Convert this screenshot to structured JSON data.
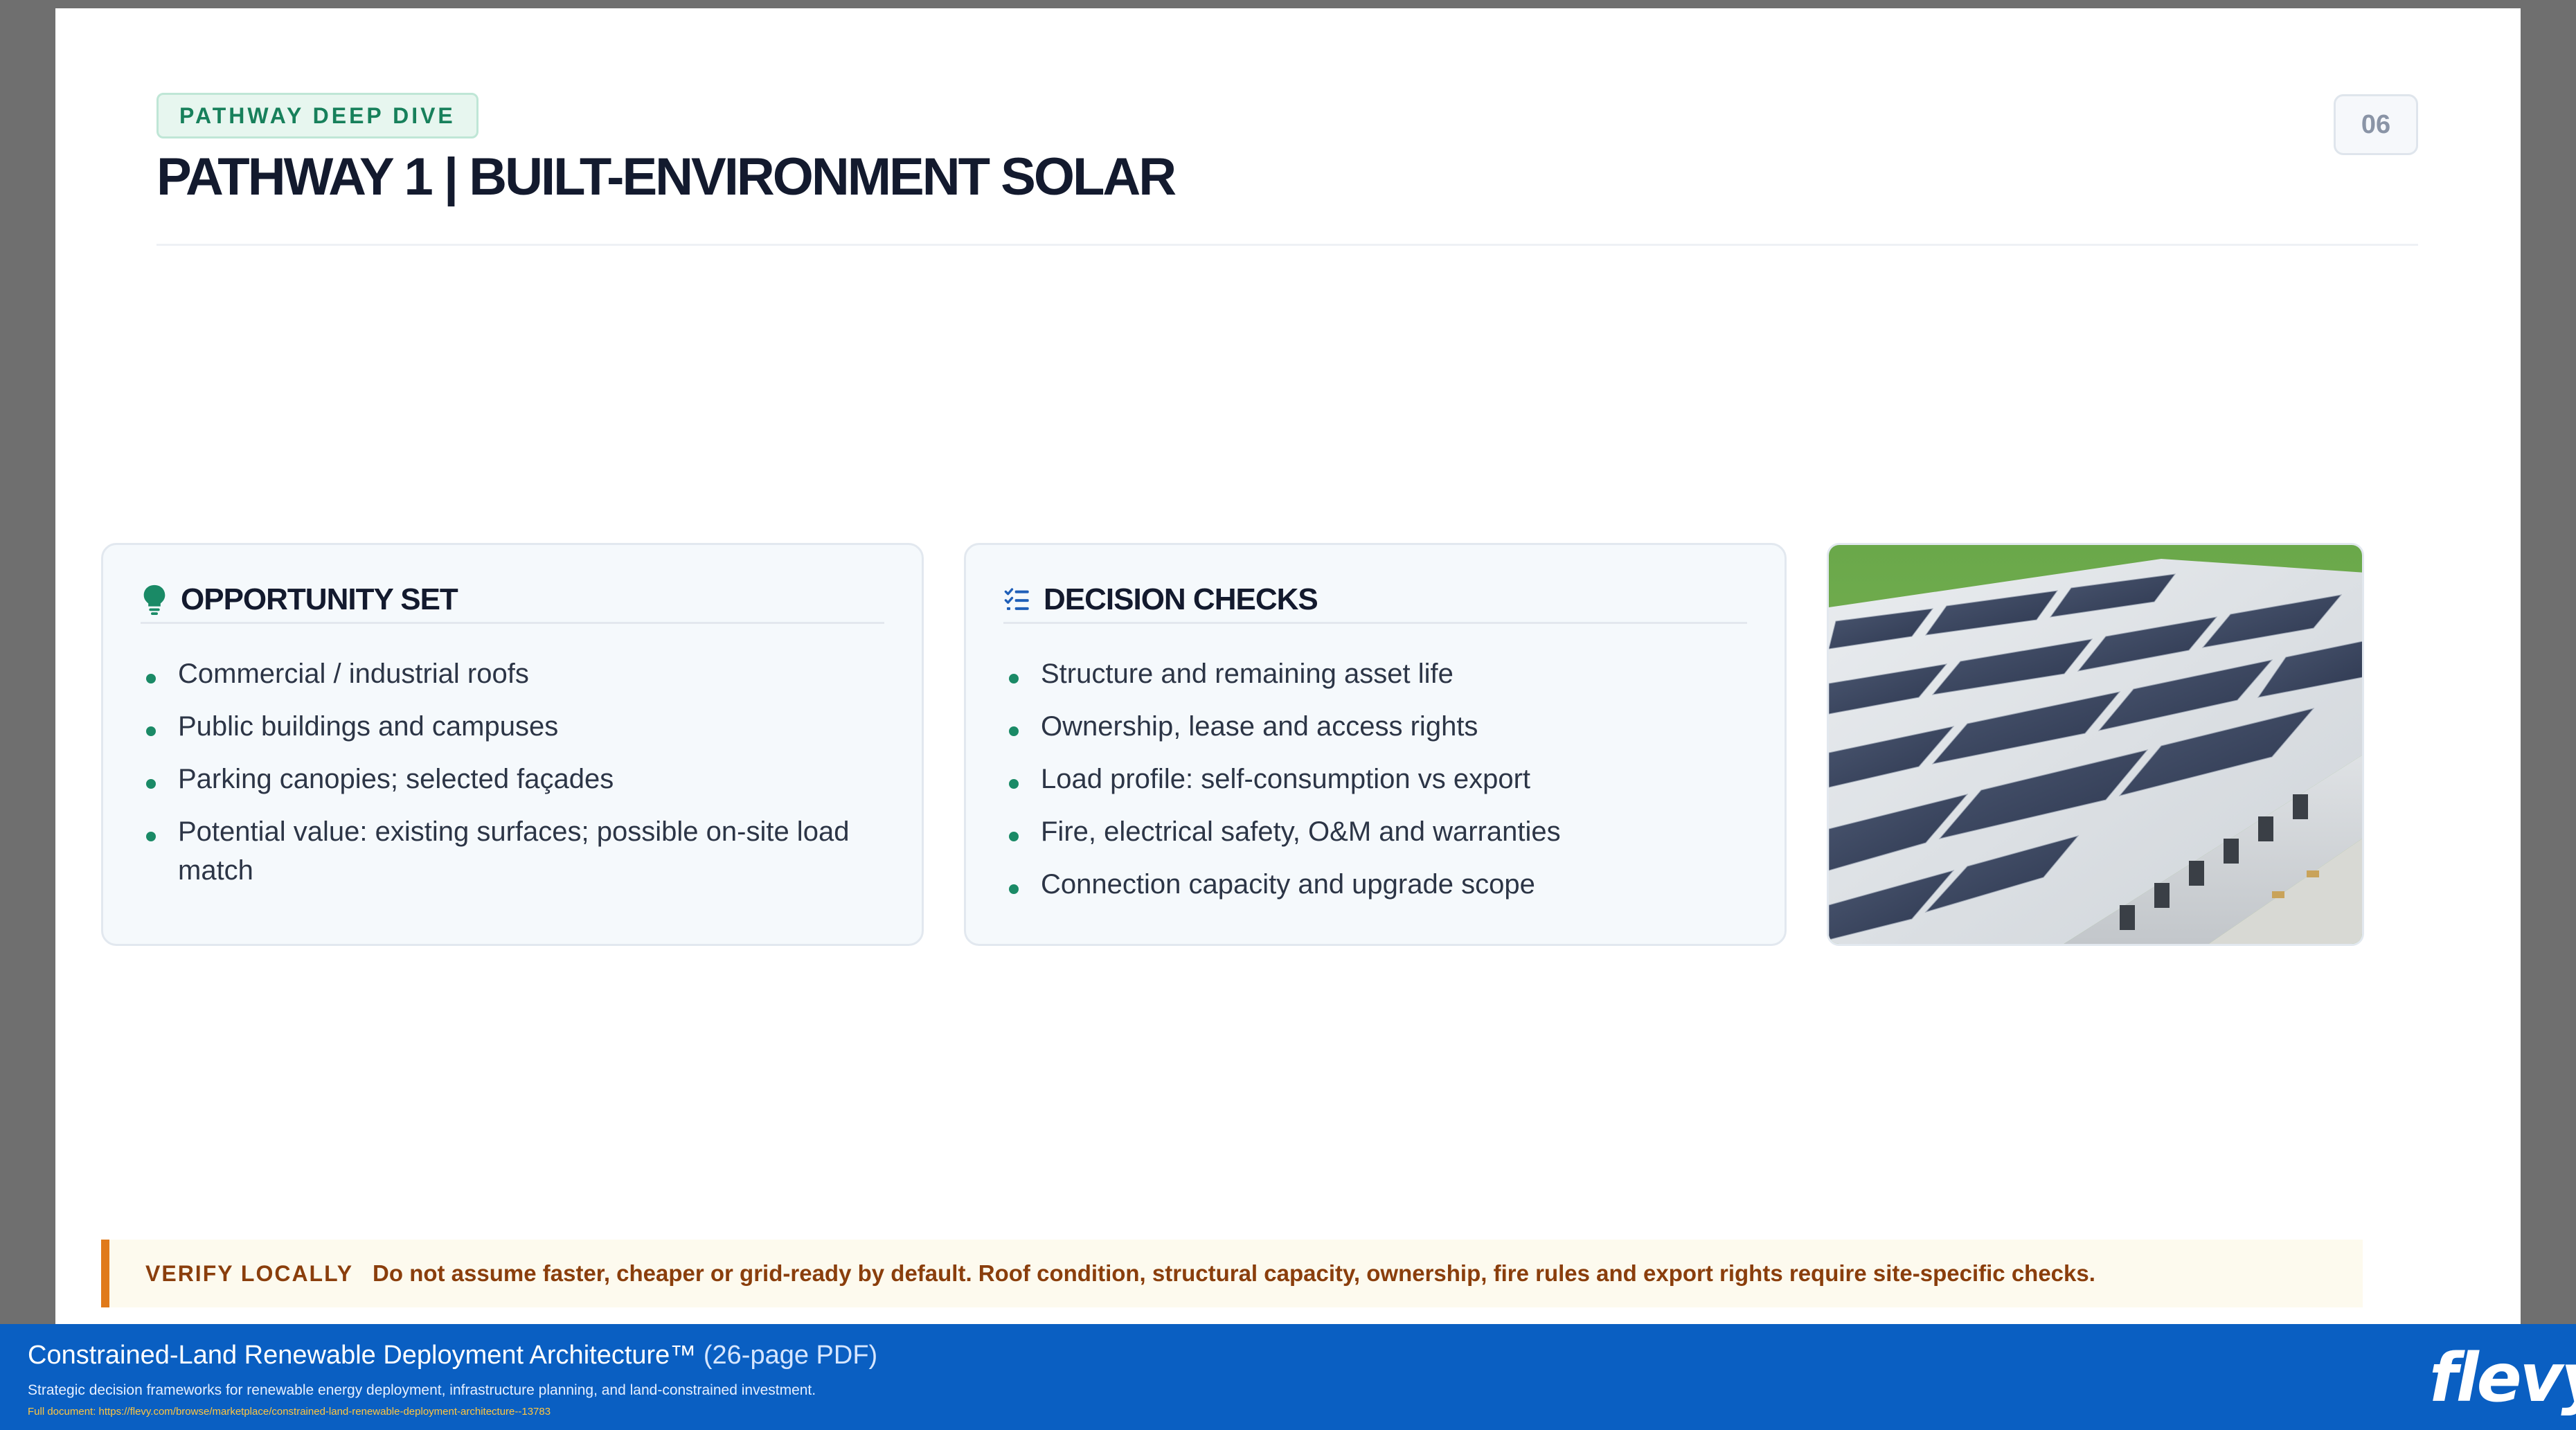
{
  "header": {
    "tag": "PATHWAY DEEP DIVE",
    "title": "PATHWAY 1 | BUILT-ENVIRONMENT SOLAR",
    "page_number": "06"
  },
  "opportunity": {
    "icon": "lightbulb-icon",
    "heading": "OPPORTUNITY SET",
    "items": [
      "Commercial / industrial roofs",
      "Public buildings and campuses",
      "Parking canopies; selected façades",
      "Potential value: existing surfaces; possible on-site load match"
    ]
  },
  "decision": {
    "icon": "checklist-icon",
    "heading": "DECISION CHECKS",
    "items": [
      "Structure and remaining asset life",
      "Ownership, lease and access rights",
      "Load profile: self-consumption vs export",
      "Fire, electrical safety, O&M and warranties",
      "Connection capacity and upgrade scope"
    ]
  },
  "notice": {
    "label": "VERIFY LOCALLY",
    "text": "Do not assume faster, cheaper or grid-ready by default. Roof condition, structural capacity, ownership, fire rules and export rights require site-specific checks."
  },
  "banner": {
    "title": "Constrained-Land Renewable Deployment Architecture™",
    "pages": "(26-page PDF)",
    "subtitle": "Strategic decision frameworks for renewable energy deployment, infrastructure planning, and land-constrained investment.",
    "link": "Full document: https://flevy.com/browse/marketplace/constrained-land-renewable-deployment-architecture--13783",
    "logo": "flevy"
  },
  "colors": {
    "accent_green": "#1a8a66",
    "warning_orange": "#e07a1a",
    "banner_blue": "#0a5fc2",
    "title_navy": "#131a2e"
  }
}
